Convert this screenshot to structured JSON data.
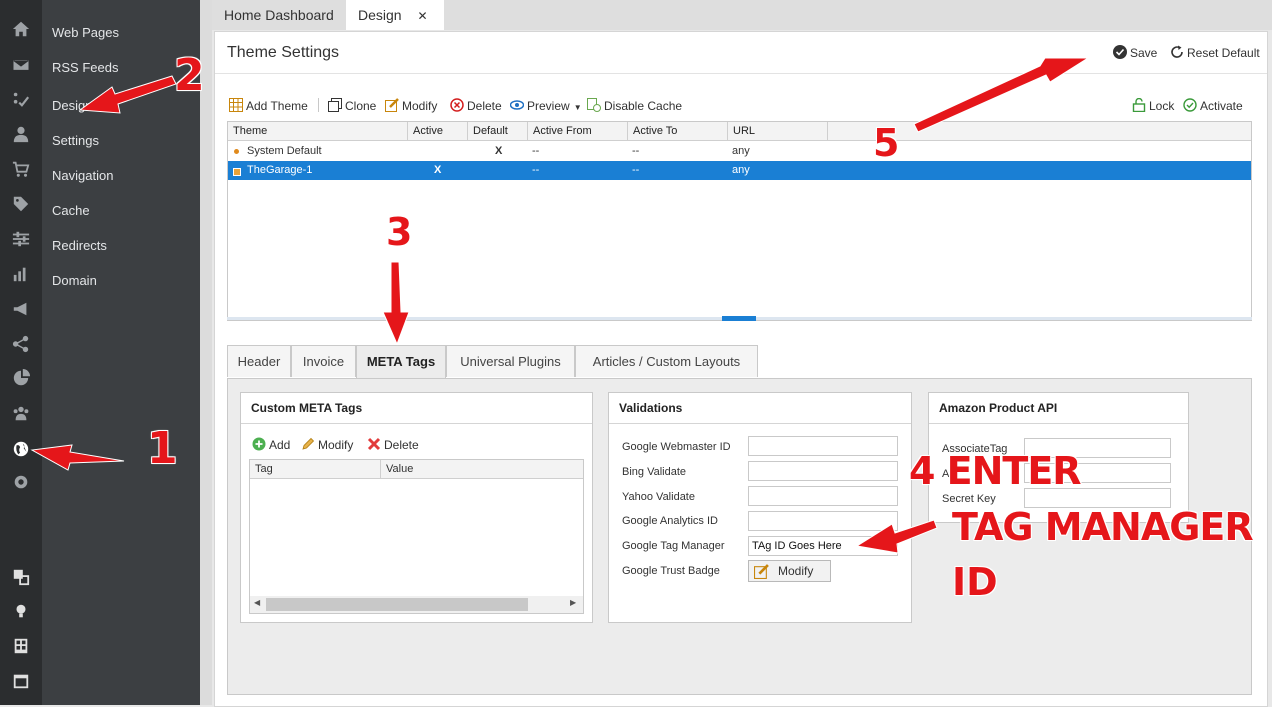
{
  "sidebar": {
    "items": [
      {
        "label": "Web Pages"
      },
      {
        "label": "RSS Feeds"
      },
      {
        "label": "Design"
      },
      {
        "label": "Settings"
      },
      {
        "label": "Navigation"
      },
      {
        "label": "Cache"
      },
      {
        "label": "Redirects"
      },
      {
        "label": "Domain"
      }
    ]
  },
  "tabs": {
    "home": "Home Dashboard",
    "design": "Design",
    "close": "✕"
  },
  "page": {
    "title": "Theme Settings",
    "save": "Save",
    "reset": "Reset Default"
  },
  "toolbar": {
    "add_theme": "Add Theme",
    "clone": "Clone",
    "modify": "Modify",
    "delete": "Delete",
    "preview": "Preview",
    "disable_cache": "Disable Cache",
    "lock": "Lock",
    "activate": "Activate"
  },
  "grid": {
    "columns": [
      "Theme",
      "Active",
      "Default",
      "Active From",
      "Active To",
      "URL"
    ],
    "rows": [
      {
        "theme": "System Default",
        "active": "",
        "default": "X",
        "from": "--",
        "to": "--",
        "url": "any"
      },
      {
        "theme": "TheGarage-1",
        "active": "X",
        "default": "",
        "from": "--",
        "to": "--",
        "url": "any"
      }
    ]
  },
  "subtabs": [
    "Header",
    "Invoice",
    "META Tags",
    "Universal Plugins",
    "Articles / Custom Layouts"
  ],
  "meta_panel": {
    "title": "Custom META Tags",
    "add": "Add",
    "modify": "Modify",
    "delete": "Delete",
    "col_tag": "Tag",
    "col_value": "Value"
  },
  "validations": {
    "title": "Validations",
    "fields": [
      {
        "label": "Google Webmaster ID",
        "value": ""
      },
      {
        "label": "Bing Validate",
        "value": ""
      },
      {
        "label": "Yahoo Validate",
        "value": ""
      },
      {
        "label": "Google Analytics ID",
        "value": ""
      },
      {
        "label": "Google Tag Manager",
        "value": "TAg ID Goes Here"
      },
      {
        "label": "Google Trust Badge",
        "value": ""
      }
    ],
    "modify_btn": "Modify"
  },
  "amazon": {
    "title": "Amazon Product API",
    "fields": [
      {
        "label": "AssociateTag"
      },
      {
        "label": "A"
      },
      {
        "label": "Secret Key"
      }
    ]
  },
  "annotations": {
    "n1": "1",
    "n2": "2",
    "n3": "3",
    "n5": "5",
    "n4_line1": "4 ENTER",
    "n4_line2": "TAG MANAGER",
    "n4_line3": "ID"
  },
  "colors": {
    "selected_row": "#1a7fd4",
    "annotation": "#e5161a",
    "sidebar": "#3c3f42",
    "rail": "#2b2d2f"
  }
}
